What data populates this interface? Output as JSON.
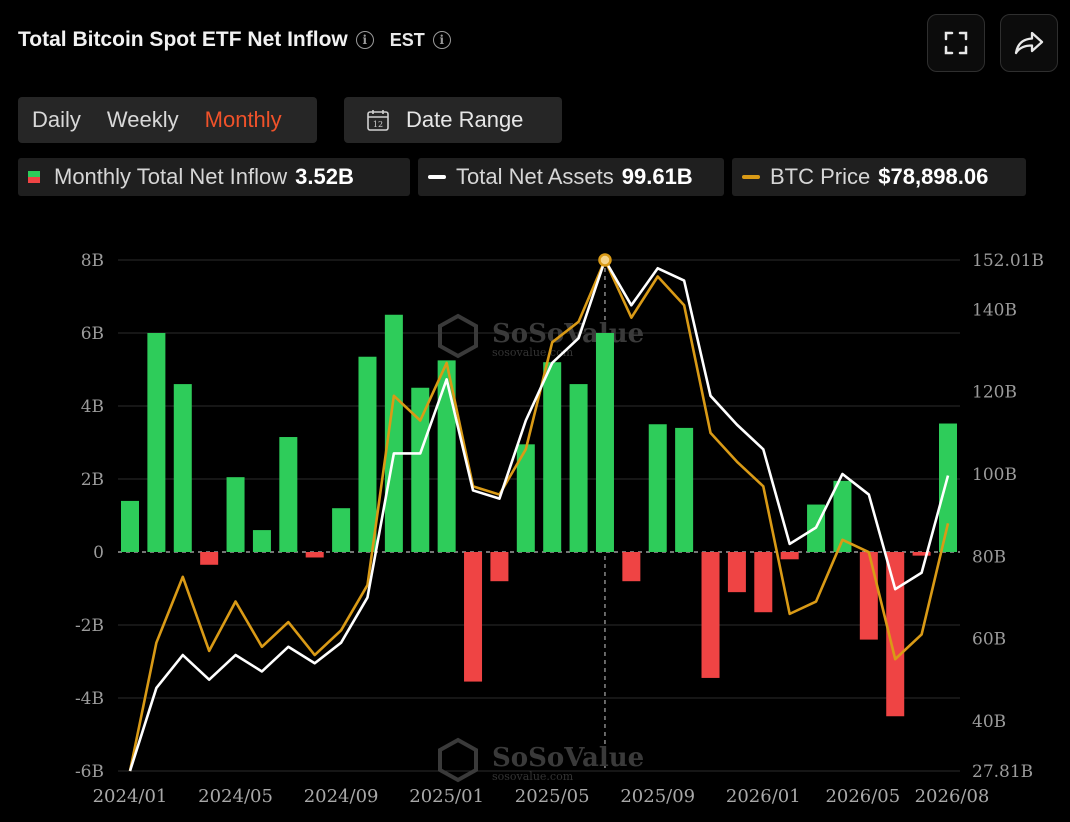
{
  "header": {
    "title": "Total Bitcoin Spot ETF Net Inflow",
    "timezone": "EST"
  },
  "tabs": [
    {
      "label": "Daily",
      "active": false
    },
    {
      "label": "Weekly",
      "active": false
    },
    {
      "label": "Monthly",
      "active": true
    }
  ],
  "date_range": {
    "label": "Date Range",
    "icon_text": "12"
  },
  "legend": {
    "inflow": {
      "label": "Monthly Total Net Inflow",
      "value": "3.52B"
    },
    "assets": {
      "label": "Total Net Assets",
      "value": "99.61B"
    },
    "price": {
      "label": "BTC Price",
      "value": "$78,898.06"
    }
  },
  "watermark": {
    "name": "SoSoValue",
    "url": "sosovalue.com"
  },
  "colors": {
    "positive": "#2ecc5a",
    "negative": "#ef4444",
    "assets": "#ffffff",
    "price": "#d99a16",
    "accent": "#f0522a"
  },
  "chart_data": {
    "type": "bar",
    "categories": [
      "2024/01",
      "2024/02",
      "2024/03",
      "2024/04",
      "2024/05",
      "2024/06",
      "2024/07",
      "2024/08",
      "2024/09",
      "2024/10",
      "2024/11",
      "2024/12",
      "2025/01",
      "2025/02",
      "2025/03",
      "2025/04",
      "2025/05",
      "2025/06",
      "2025/07",
      "2025/08",
      "2025/09",
      "2025/10",
      "2025/11",
      "2025/12",
      "2026/01",
      "2026/02",
      "2026/03",
      "2026/04",
      "2026/05",
      "2026/06",
      "2026/07",
      "2026/08"
    ],
    "x_tick_labels": [
      "2024/01",
      "2024/05",
      "2024/09",
      "2025/01",
      "2025/05",
      "2025/09",
      "2026/01",
      "2026/05",
      "2026/08"
    ],
    "series": [
      {
        "name": "Monthly Total Net Inflow",
        "axis": "left",
        "values": [
          1.4,
          6.0,
          4.6,
          -0.35,
          2.05,
          0.6,
          3.15,
          -0.15,
          1.2,
          5.35,
          6.5,
          4.5,
          5.25,
          -3.55,
          -0.8,
          2.95,
          5.2,
          4.6,
          6.0,
          -0.8,
          3.5,
          3.4,
          -3.45,
          -1.1,
          -1.65,
          -0.2,
          1.3,
          1.95,
          -2.4,
          -4.5,
          -0.1,
          3.52
        ]
      },
      {
        "name": "Total Net Assets",
        "axis": "right",
        "values": [
          27.81,
          48,
          56,
          50,
          56,
          52,
          58,
          54,
          59,
          70,
          105,
          105,
          123,
          96,
          94,
          113,
          127,
          133,
          152.01,
          141,
          150,
          147,
          119,
          112,
          106,
          83,
          87,
          100,
          95,
          72,
          76,
          99.61
        ]
      },
      {
        "name": "BTC Price",
        "axis": "right",
        "values": [
          27.81,
          59,
          75,
          57,
          69,
          58,
          64,
          56,
          62,
          73,
          119,
          113,
          127,
          97,
          95,
          106,
          132,
          137,
          152.01,
          138,
          148,
          141,
          110,
          103,
          97,
          66,
          69,
          84,
          81,
          55,
          61,
          88
        ]
      }
    ],
    "ylim": [
      -6,
      8
    ],
    "yticks": [
      -6,
      -4,
      -2,
      0,
      2,
      4,
      6,
      8
    ],
    "ytick_labels": [
      "-6B",
      "-4B",
      "-2B",
      "0",
      "2B",
      "4B",
      "6B",
      "8B"
    ],
    "y2lim": [
      27.81,
      152.01
    ],
    "y2ticks": [
      27.81,
      40,
      60,
      80,
      100,
      120,
      140,
      152.01
    ],
    "y2tick_labels": [
      "27.81B",
      "40B",
      "60B",
      "80B",
      "100B",
      "120B",
      "140B",
      "152.01B"
    ],
    "highlight_index": 18,
    "grid": true
  }
}
